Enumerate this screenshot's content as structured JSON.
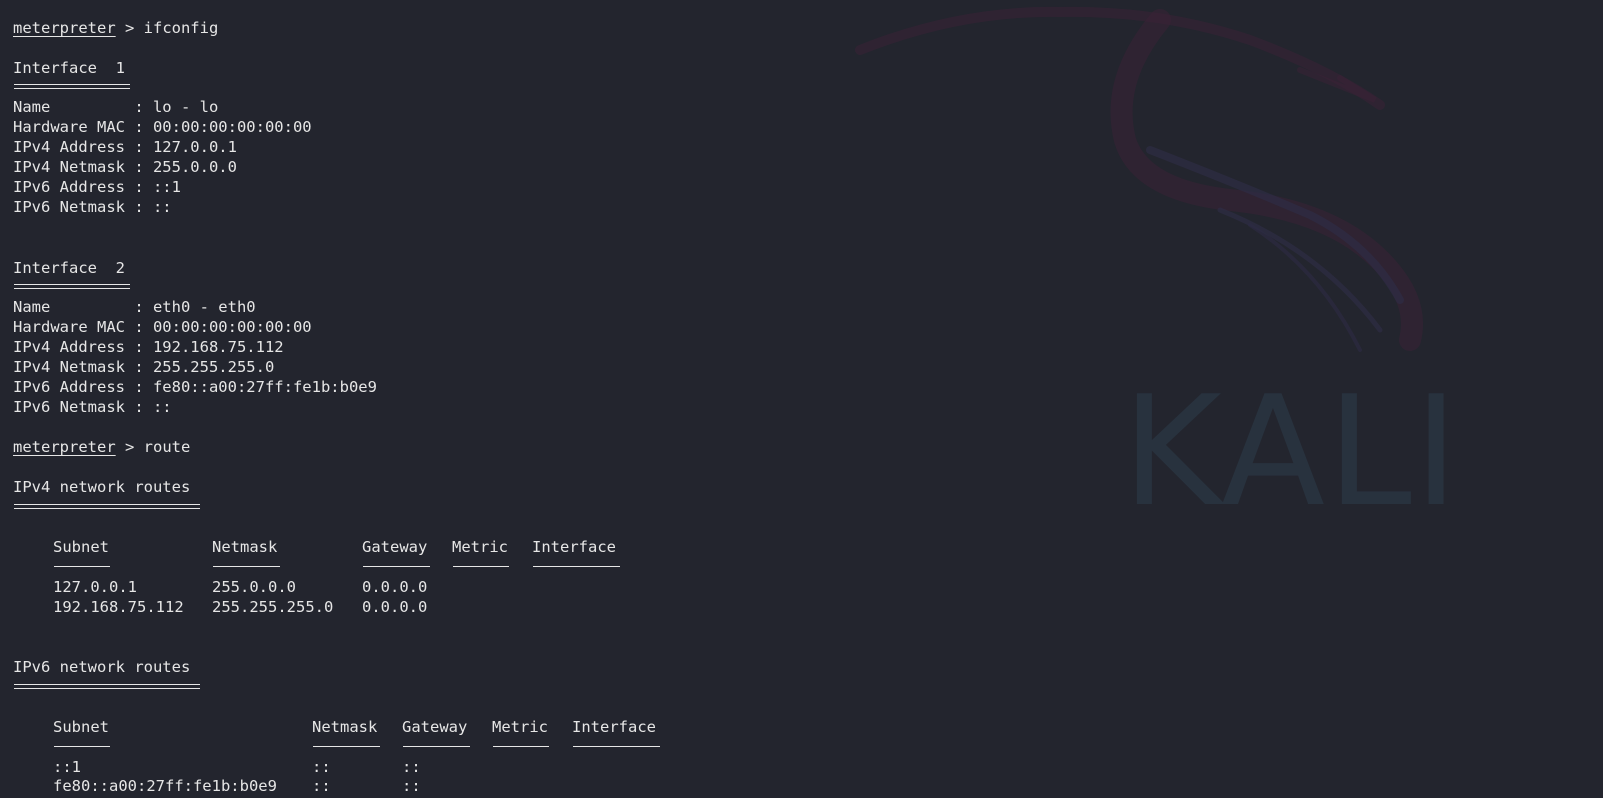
{
  "wallpaper": {
    "brand_text": "KALI",
    "icon": "kali-dragon-icon",
    "colors": {
      "background": "#23252e",
      "watermark_text": "#28323e",
      "dragon": "#3a2236"
    }
  },
  "session": {
    "ifconfig_prompt": "meterpreter",
    "ifconfig_command": " > ifconfig",
    "interfaces": [
      {
        "heading": "Interface  1",
        "lines": [
          "Name         : lo - lo",
          "Hardware MAC : 00:00:00:00:00:00",
          "IPv4 Address : 127.0.0.1",
          "IPv4 Netmask : 255.0.0.0",
          "IPv6 Address : ::1",
          "IPv6 Netmask : ::"
        ]
      },
      {
        "heading": "Interface  2",
        "lines": [
          "Name         : eth0 - eth0",
          "Hardware MAC : 00:00:00:00:00:00",
          "IPv4 Address : 192.168.75.112",
          "IPv4 Netmask : 255.255.255.0",
          "IPv6 Address : fe80::a00:27ff:fe1b:b0e9",
          "IPv6 Netmask : ::"
        ]
      }
    ],
    "route_prompt": "meterpreter",
    "route_command": " > route",
    "ipv4_routes": {
      "heading": "IPv4 network routes",
      "columns": [
        "Subnet",
        "Netmask",
        "Gateway",
        "Metric",
        "Interface"
      ],
      "rows": [
        [
          "127.0.0.1",
          "255.0.0.0",
          "0.0.0.0",
          "",
          ""
        ],
        [
          "192.168.75.112",
          "255.255.255.0",
          "0.0.0.0",
          "",
          ""
        ]
      ]
    },
    "ipv6_routes": {
      "heading": "IPv6 network routes",
      "columns": [
        "Subnet",
        "Netmask",
        "Gateway",
        "Metric",
        "Interface"
      ],
      "rows": [
        [
          "::1",
          "::",
          "::",
          "",
          ""
        ],
        [
          "fe80::a00:27ff:fe1b:b0e9",
          "::",
          "::",
          "",
          ""
        ]
      ]
    }
  }
}
